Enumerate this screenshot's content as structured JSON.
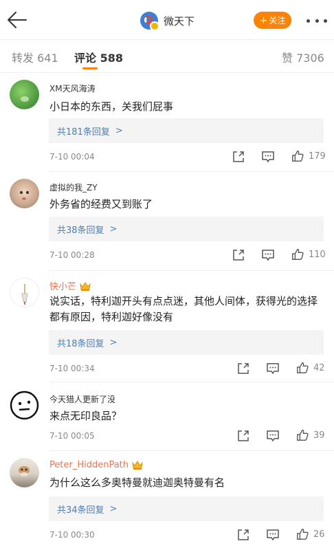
{
  "header": {
    "title": "微天下",
    "follow_label": "关注"
  },
  "tabs": {
    "reposts": "转发 641",
    "comments": "评论 588",
    "likes": "赞 7306"
  },
  "comments": [
    {
      "user": "XM天风海涛",
      "text": "小日本的东西，关我们屁事",
      "replies": "共181条回复",
      "time": "7-10 00:04",
      "likes": "179"
    },
    {
      "user": "虚拟的我_ZY",
      "text": "外务省的经费又到账了",
      "replies": "共38条回复",
      "time": "7-10 00:28",
      "likes": "110"
    },
    {
      "user": "快小芒",
      "text": "说实话，特利迦开头有点点迷，其他人间体，获得光的选择都有原因，特利迦好像没有",
      "replies": "共18条回复",
      "time": "7-10 00:34",
      "likes": "42"
    },
    {
      "user": "今天猎人更新了没",
      "text": "来点无印良品？",
      "time": "7-10 00:05",
      "likes": "39"
    },
    {
      "user": "Peter_HiddenPath",
      "text": "为什么这么多奥特曼就迪迦奥特曼有名",
      "replies": "共34条回复",
      "time": "7-10 00:30",
      "likes": "26"
    }
  ]
}
